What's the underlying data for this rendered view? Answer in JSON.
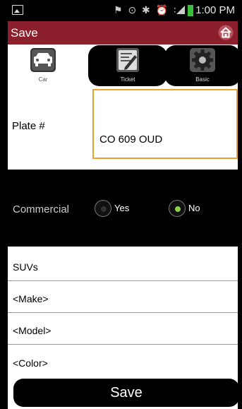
{
  "status_bar": {
    "time": "1:00 PM",
    "icons": "☹ ⊕ ✱ ⏰ ❶"
  },
  "action_bar": {
    "title": "Save",
    "home_icon": "home-icon"
  },
  "tabs": [
    {
      "label": "Car",
      "icon": "car-icon"
    },
    {
      "label": "Ticket",
      "icon": "ticket-icon"
    },
    {
      "label": "Basic",
      "icon": "gear-icon"
    }
  ],
  "plate": {
    "label": "Plate #",
    "value": "CO 609 OUD"
  },
  "commercial": {
    "label": "Commercial",
    "options": [
      {
        "label": "Yes",
        "selected": false
      },
      {
        "label": "No",
        "selected": true
      }
    ]
  },
  "vehicle_fields": [
    {
      "value": "SUVs"
    },
    {
      "value": "<Make>"
    },
    {
      "value": "<Model>"
    },
    {
      "value": "<Color>"
    }
  ],
  "save_button": {
    "label": "Save"
  },
  "colors": {
    "action_bar": "#8b1f2c",
    "focus_border": "#f0a030",
    "radio_selected": "#8fd14f"
  }
}
